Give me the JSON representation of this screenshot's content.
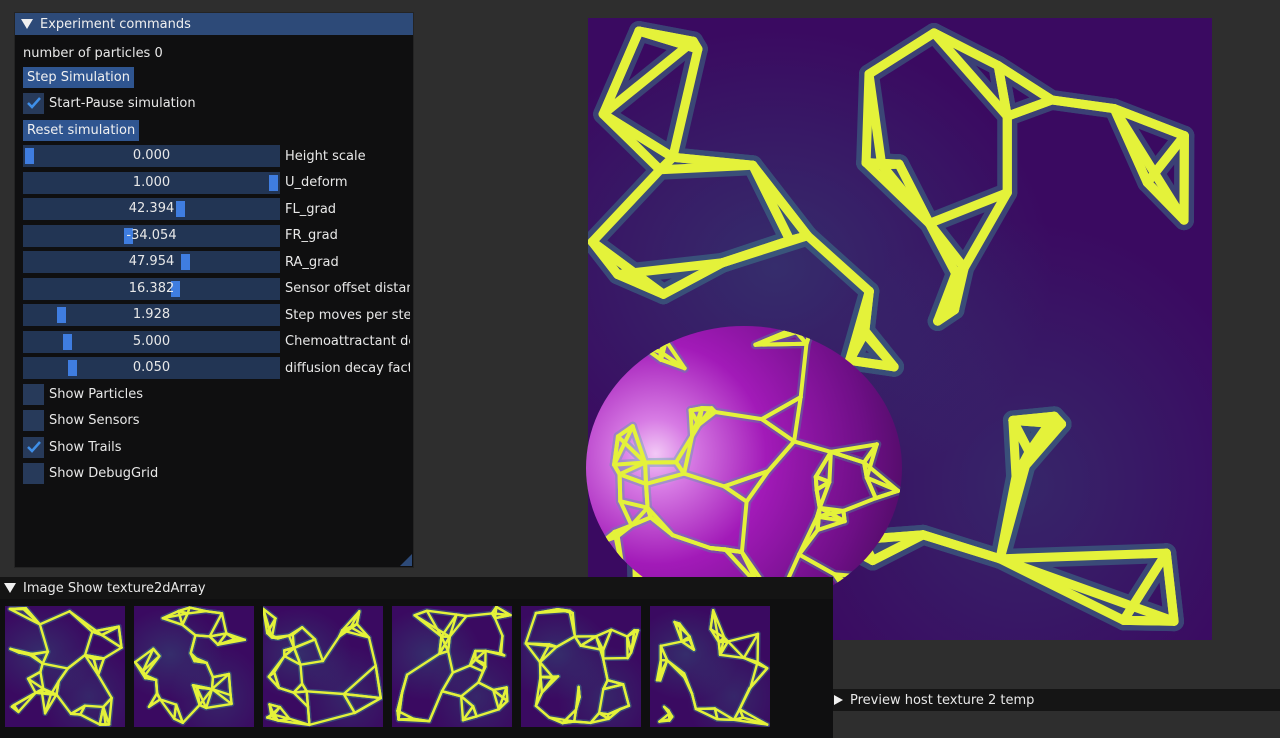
{
  "experiment_panel": {
    "title": "Experiment commands",
    "particle_count_text": "number of particles 0",
    "step_button": "Step Simulation",
    "start_pause_label": "Start-Pause simulation",
    "start_pause_checked": true,
    "reset_button": "Reset simulation",
    "sliders": [
      {
        "value": "0.000",
        "label": "Height scale",
        "fraction": 0.0
      },
      {
        "value": "1.000",
        "label": "U_deform",
        "fraction": 1.0
      },
      {
        "value": "42.394",
        "label": "FL_grad",
        "fraction": 0.62
      },
      {
        "value": "-34.054",
        "label": "FR_grad",
        "fraction": 0.405
      },
      {
        "value": "47.954",
        "label": "RA_grad",
        "fraction": 0.64
      },
      {
        "value": "16.382",
        "label": "Sensor offset distanc",
        "fraction": 0.6
      },
      {
        "value": "1.928",
        "label": "Step moves per step (",
        "fraction": 0.13
      },
      {
        "value": "5.000",
        "label": "Chemoattractant dep",
        "fraction": 0.155
      },
      {
        "value": "0.050",
        "label": "diffusion decay factor",
        "fraction": 0.175
      }
    ],
    "checkboxes": [
      {
        "label": "Show Particles",
        "checked": false
      },
      {
        "label": "Show Sensors",
        "checked": false
      },
      {
        "label": "Show Trails",
        "checked": true
      },
      {
        "label": "Show DebugGrid",
        "checked": false
      }
    ]
  },
  "texture_panel": {
    "title": "Image Show texture2dArray",
    "thumbnail_count": 6
  },
  "preview_panel": {
    "title": "Preview host texture 2 temp"
  },
  "colors": {
    "title_bar": "#2d4a78",
    "button": "#2f5590",
    "slider_bg": "#223554",
    "slider_grab": "#3f7de0",
    "trail_yellow": "#e4f23a",
    "field_purple": "#3a0a61",
    "sphere_magenta": "#a21ab8"
  }
}
